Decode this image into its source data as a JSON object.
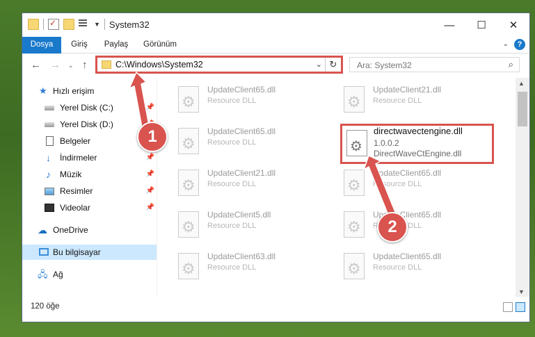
{
  "window": {
    "title": "System32",
    "controls": {
      "minimize": "—",
      "maximize": "☐",
      "close": "✕"
    }
  },
  "ribbon": {
    "tabs": [
      {
        "label": "Dosya"
      },
      {
        "label": "Giriş"
      },
      {
        "label": "Paylaş"
      },
      {
        "label": "Görünüm"
      }
    ],
    "help": "?"
  },
  "address": {
    "path": "C:\\Windows\\System32",
    "search_placeholder": "Ara: System32"
  },
  "nav": {
    "items": [
      {
        "label": "Hızlı erişim",
        "icon": "star-icon",
        "pinned": false
      },
      {
        "label": "Yerel Disk (C:)",
        "icon": "drive-icon",
        "pinned": true
      },
      {
        "label": "Yerel Disk (D:)",
        "icon": "drive-icon",
        "pinned": true
      },
      {
        "label": "Belgeler",
        "icon": "documents-icon",
        "pinned": true
      },
      {
        "label": "İndirmeler",
        "icon": "downloads-icon",
        "pinned": true
      },
      {
        "label": "Müzik",
        "icon": "music-icon",
        "pinned": true
      },
      {
        "label": "Resimler",
        "icon": "pictures-icon",
        "pinned": true
      },
      {
        "label": "Videolar",
        "icon": "videos-icon",
        "pinned": true
      },
      {
        "label": "OneDrive",
        "icon": "cloud-icon",
        "pinned": false
      },
      {
        "label": "Bu bilgisayar",
        "icon": "computer-icon",
        "pinned": false,
        "selected": true
      },
      {
        "label": "Ağ",
        "icon": "network-icon",
        "pinned": false
      }
    ]
  },
  "files": [
    {
      "name": "UpdateClient65.dll",
      "desc": "Resource DLL"
    },
    {
      "name": "UpdateClient21.dll",
      "desc": "Resource DLL"
    },
    {
      "name": "UpdateClient65.dll",
      "desc": "Resource DLL"
    },
    {
      "name": "UpdateClient21.dll",
      "desc": "Resource DLL"
    },
    {
      "name": "UpdateClient65.dll",
      "desc": "Resource DLL"
    },
    {
      "name": "UpdateClient5.dll",
      "desc": "Resource DLL"
    },
    {
      "name": "UpdateClient65.dll",
      "desc": "Resource DLL"
    },
    {
      "name": "UpdateClient63.dll",
      "desc": "Resource DLL"
    },
    {
      "name": "UpdateClient65.dll",
      "desc": "Resource DLL"
    }
  ],
  "highlighted_file": {
    "name": "directwavectengine.dll",
    "version": "1.0.0.2",
    "desc": "DirectWaveCtEngine.dll"
  },
  "status": {
    "item_count": "120 öğe"
  },
  "markers": {
    "one": "1",
    "two": "2"
  },
  "colors": {
    "accent": "#1979ca",
    "highlight": "#d9534f",
    "selection": "#cce8ff"
  }
}
